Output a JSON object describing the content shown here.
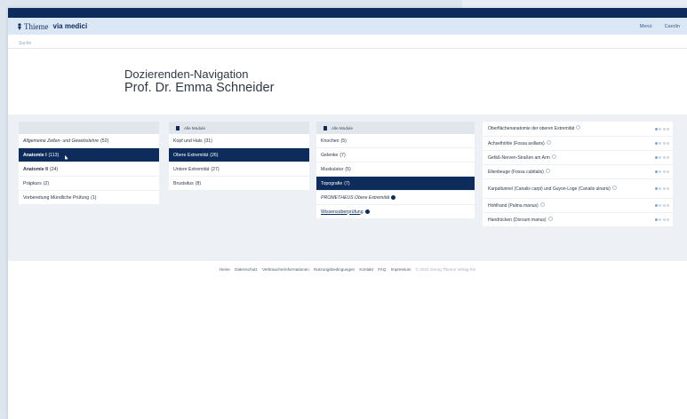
{
  "header": {
    "brand": "Thieme",
    "brand_sub": "via medici",
    "menu_label": "Menü",
    "user_label": "Carolin"
  },
  "breadcrumb": "Suche",
  "hero": {
    "title": "Dozierenden-Navigation",
    "subtitle": "Prof. Dr. Emma Schneider"
  },
  "columns": {
    "col1": {
      "items": [
        {
          "label": "Allgemeine Zellen- und Gewebslehre",
          "count": "(52)"
        },
        {
          "label": "Anatomie I",
          "count": "(113)"
        },
        {
          "label": "Anatomie II",
          "count": "(24)"
        },
        {
          "label": "Präpkurs",
          "count": "(2)"
        },
        {
          "label": "Vorbereitung Mündliche Prüfung",
          "count": "(1)"
        }
      ]
    },
    "col2": {
      "header": "Alle Module",
      "items": [
        {
          "label": "Kopf und Hals",
          "count": "(31)"
        },
        {
          "label": "Obere Extremität",
          "count": "(26)"
        },
        {
          "label": "Untere Extremität",
          "count": "(27)"
        },
        {
          "label": "Brustsitus",
          "count": "(8)"
        }
      ]
    },
    "col3": {
      "header": "Alle Module",
      "items": [
        {
          "label": "Knochen",
          "count": "(5)"
        },
        {
          "label": "Gelenke",
          "count": "(7)"
        },
        {
          "label": "Muskulatur",
          "count": "(5)"
        },
        {
          "label": "Topografie",
          "count": "(7)"
        },
        {
          "label": "PROMETHEUS Obere Extremität",
          "count": ""
        },
        {
          "label": "Wissensüberprüfung",
          "count": ""
        }
      ]
    },
    "col4": {
      "items": [
        {
          "label": "Oberflächenanatomie der oberen Extremität",
          "progress": 1
        },
        {
          "label": "Achselhöhle (Fossa axillaris)",
          "progress": 1
        },
        {
          "label": "Gefäß-Nerven-Straßen am Arm",
          "progress": 1
        },
        {
          "label": "Ellenbeuge (Fossa cubitalis)",
          "progress": 1
        },
        {
          "label": "Karpaltunnel (Canalis carpi) und Guyon-Loge (Canalis ulnaris)",
          "progress": 1
        },
        {
          "label": "Hohlhand (Palma manus)",
          "progress": 1
        },
        {
          "label": "Handrücken (Dorsum manus)",
          "progress": 1
        }
      ],
      "progress_max": 4
    }
  },
  "footer": {
    "links": [
      "Home",
      "Datenschutz",
      "Verbraucherinformationen",
      "Nutzungsbedingungen",
      "Kontakt",
      "FAQ",
      "Impressum"
    ],
    "copyright": "© 2021 Georg Thieme Verlag KG"
  },
  "colors": {
    "primary": "#0d2c5c",
    "navbar_bg": "#dbe7f5",
    "content_bg": "#edf1f5",
    "accent_light": "#79a9d6"
  },
  "icons": [
    "thieme-logo-icon",
    "module-icon",
    "info-icon",
    "progress-dots-icon",
    "mouse-cursor-icon"
  ]
}
